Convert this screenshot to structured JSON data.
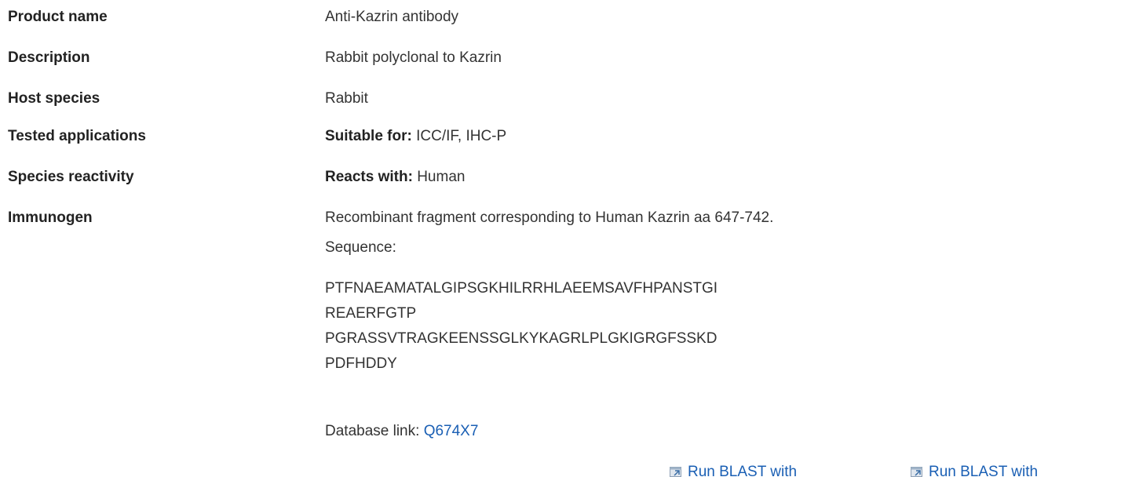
{
  "rows": [
    {
      "label": "Product name",
      "value": "Anti-Kazrin antibody"
    },
    {
      "label": "Description",
      "value": "Rabbit polyclonal to Kazrin"
    },
    {
      "label": "Host species",
      "value": "Rabbit"
    },
    {
      "label": "Tested applications",
      "prefix": "Suitable for:",
      "value": " ICC/IF, IHC-P"
    },
    {
      "label": "Species reactivity",
      "prefix": "Reacts with:",
      "value": " Human"
    },
    {
      "label": "Immunogen",
      "value": "Recombinant fragment corresponding to Human Kazrin aa 647-742."
    }
  ],
  "immunogen": {
    "sequence_label": "Sequence:",
    "sequence_lines": [
      "PTFNAEAMATALGIPSGKHILRRHLAEEMSAVFHPANSTGI",
      "REAERFGTP",
      "PGRASSVTRAGKEENSSGLKYKAGRLPLGKIGRGFSSKD",
      "PDFHDDY"
    ],
    "database_link_label": "Database link:",
    "database_link_id": "Q674X7",
    "blast_buttons": [
      {
        "label": "Run BLAST with",
        "icon": "external-link-icon"
      },
      {
        "label": "Run BLAST with",
        "icon": "external-link-icon"
      }
    ]
  },
  "colors": {
    "link": "#1a5fb4",
    "label_text": "#222222",
    "body_text": "#333333"
  }
}
